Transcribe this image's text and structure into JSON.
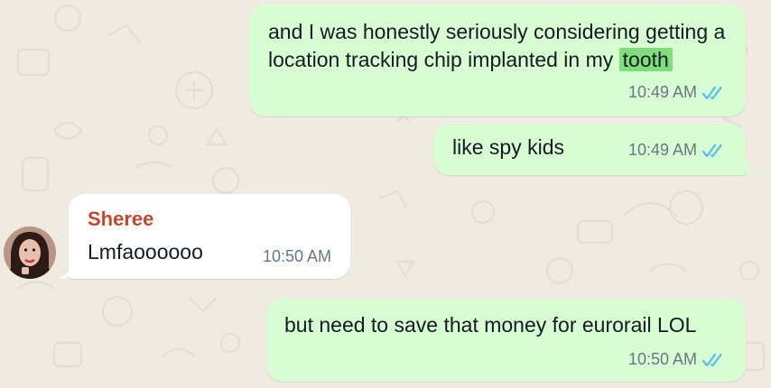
{
  "colors": {
    "outgoing_bubble": "#d9fdd3",
    "incoming_bubble": "#ffffff",
    "wallpaper": "#efeae2",
    "highlight": "#7dde7a",
    "read_ticks": "#53bdeb",
    "sender_name": "#c0492b"
  },
  "messages": [
    {
      "direction": "outgoing",
      "text_before": "and I was honestly seriously considering getting a location tracking chip implanted in my ",
      "highlighted": "tooth",
      "time": "10:49 AM",
      "status_icon": "double-check-read-icon"
    },
    {
      "direction": "outgoing",
      "text": "like spy kids",
      "time": "10:49 AM",
      "status_icon": "double-check-read-icon"
    },
    {
      "direction": "incoming",
      "sender": "Sheree",
      "text": "Lmfaoooooo",
      "time": "10:50 AM",
      "avatar": "contact-avatar"
    },
    {
      "direction": "outgoing",
      "text": "but need to save that money for eurorail LOL",
      "time": "10:50 AM",
      "status_icon": "double-check-read-icon"
    }
  ]
}
